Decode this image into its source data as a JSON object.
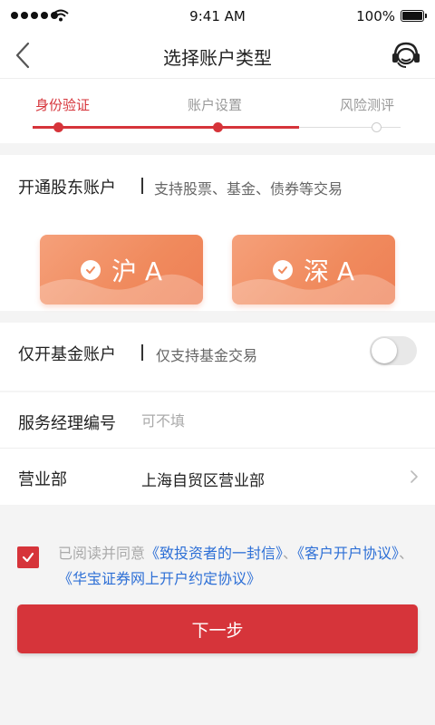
{
  "status": {
    "time": "9:41 AM",
    "battery_text": "100%"
  },
  "nav": {
    "title": "选择账户类型",
    "back_icon": "chevron-left-icon",
    "service_icon": "customer-service-icon"
  },
  "steps": {
    "items": [
      {
        "label": "身份验证",
        "state": "done"
      },
      {
        "label": "账户设置",
        "state": "current"
      },
      {
        "label": "风险测评",
        "state": "todo"
      }
    ],
    "accent": "#d6343a"
  },
  "shareholder": {
    "title": "开通股东账户",
    "subtitle": "支持股票、基金、债券等交易",
    "markets": [
      {
        "label": "沪 A",
        "selected": true
      },
      {
        "label": "深 A",
        "selected": true
      }
    ]
  },
  "fund": {
    "title": "仅开基金账户",
    "subtitle": "仅支持基金交易",
    "enabled": false
  },
  "manager": {
    "label": "服务经理编号",
    "value": "",
    "placeholder": "可不填"
  },
  "branch": {
    "label": "营业部",
    "value": "上海自贸区营业部"
  },
  "agreement": {
    "checked": true,
    "prefix": "已阅读并同意",
    "link1": "《致投资者的一封信》",
    "sep1": "、",
    "link2": "《客户开户协议》",
    "sep2": "、",
    "link3": "《华宝证券网上开户约定协议》"
  },
  "next_label": "下一步",
  "colors": {
    "brand_red": "#d6343a",
    "market_orange": "#f08a5d",
    "link_blue": "#2d6fd6"
  }
}
